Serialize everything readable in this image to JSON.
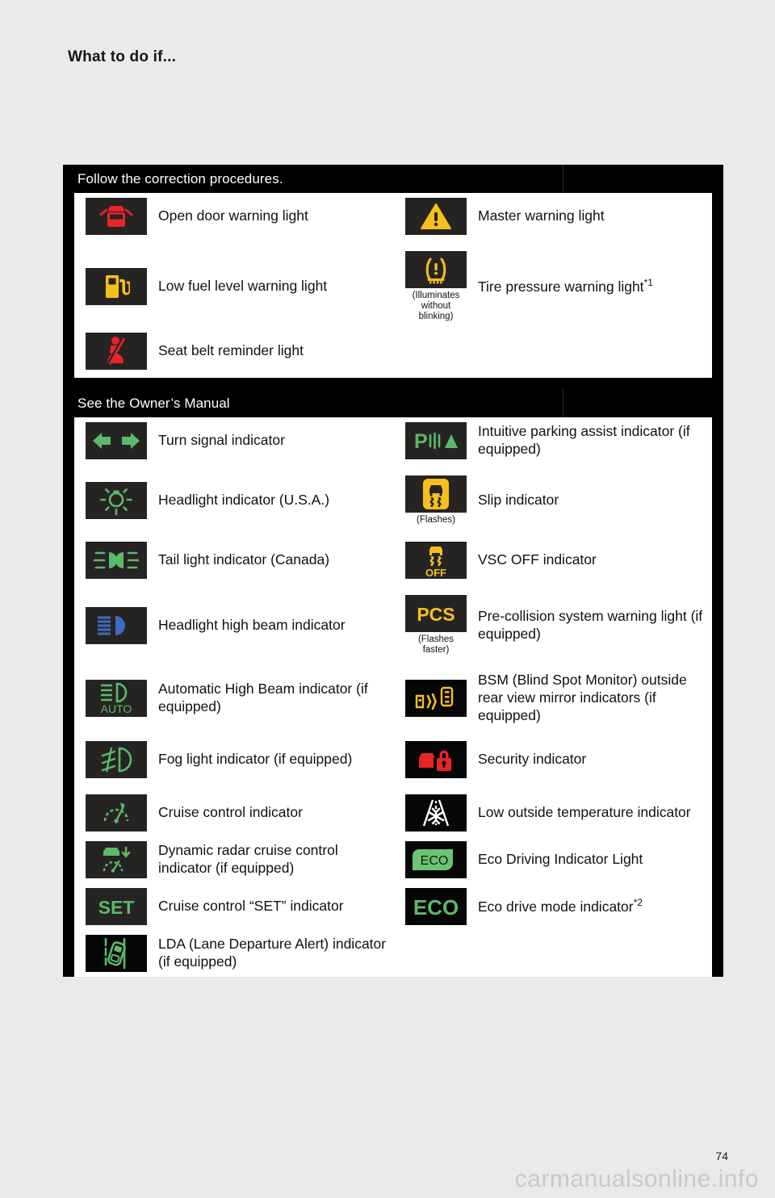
{
  "page": {
    "title": "What to do if...",
    "page_number": "74",
    "watermark": "carmanualsonline.info"
  },
  "colors": {
    "green": "#5cb96a",
    "yellow": "#f5c01e",
    "red": "#e8232a",
    "blue": "#3c6cc4",
    "white": "#ffffff",
    "tile_bg": "#262422",
    "tile_bg_black": "#060606"
  },
  "sections": [
    {
      "id": "follow-the-correction-procedures",
      "heading": "Follow the correction procedures.",
      "rows": [
        {
          "left": {
            "icon": "open-door-warning-icon",
            "label": "Open door warning light",
            "note": ""
          },
          "right": {
            "icon": "master-warning-icon",
            "label": "Master warning light",
            "note": ""
          }
        },
        {
          "left": {
            "icon": "low-fuel-level-icon",
            "label": "Low fuel level warning light",
            "note": ""
          },
          "right": {
            "icon": "tire-pressure-warning-icon",
            "label": "Tire pressure warning light",
            "sup": "*1",
            "note": "(Illuminates\nwithout\nblinking)"
          }
        },
        {
          "left": {
            "icon": "seat-belt-reminder-icon",
            "label": "Seat belt reminder light",
            "note": ""
          },
          "right": null
        }
      ]
    },
    {
      "id": "see-the-owners-manual",
      "heading": "See the Owner’s Manual",
      "rows": [
        {
          "left": {
            "icon": "turn-signal-icon",
            "label": "Turn signal indicator",
            "note": ""
          },
          "right": {
            "icon": "intuitive-parking-assist-icon",
            "label": "Intuitive parking assist indicator (if equipped)",
            "note": ""
          }
        },
        {
          "left": {
            "icon": "headlight-usa-icon",
            "label": "Headlight indicator (U.S.A.)",
            "note": ""
          },
          "right": {
            "icon": "slip-indicator-icon",
            "label": "Slip indicator",
            "note": "(Flashes)"
          }
        },
        {
          "left": {
            "icon": "tail-light-canada-icon",
            "label": "Tail light indicator (Canada)",
            "note": ""
          },
          "right": {
            "icon": "vsc-off-icon",
            "label": "VSC OFF indicator",
            "note": ""
          }
        },
        {
          "left": {
            "icon": "headlight-high-beam-icon",
            "label": "Headlight high beam indicator",
            "note": ""
          },
          "right": {
            "icon": "pcs-warning-icon",
            "label": "Pre-collision system warning light (if equipped)",
            "note": "(Flashes\nfaster)"
          }
        },
        {
          "left": {
            "icon": "automatic-high-beam-icon",
            "label": "Automatic High Beam indicator (if equipped)",
            "note": ""
          },
          "right": {
            "icon": "bsm-mirror-icon",
            "label": "BSM (Blind Spot Monitor) outside rear view mirror indicators (if equipped)",
            "note": ""
          }
        },
        {
          "left": {
            "icon": "fog-light-icon",
            "label": "Fog light indicator (if equipped)",
            "note": ""
          },
          "right": {
            "icon": "security-indicator-icon",
            "label": "Security indicator",
            "note": ""
          }
        },
        {
          "left": {
            "icon": "cruise-control-icon",
            "label": "Cruise control indicator",
            "note": ""
          },
          "right": {
            "icon": "low-outside-temperature-icon",
            "label": "Low outside temperature indicator",
            "note": ""
          }
        },
        {
          "left": {
            "icon": "dynamic-radar-cruise-icon",
            "label": "Dynamic radar cruise control indicator (if equipped)",
            "note": ""
          },
          "right": {
            "icon": "eco-driving-leaf-icon",
            "label": "Eco Driving Indicator Light",
            "note": ""
          }
        },
        {
          "left": {
            "icon": "cruise-set-icon",
            "label": "Cruise control “SET” indicator",
            "note": ""
          },
          "right": {
            "icon": "eco-drive-mode-icon",
            "label": "Eco drive mode indicator",
            "sup": "*2",
            "note": ""
          }
        },
        {
          "left": {
            "icon": "lda-icon",
            "label": "LDA (Lane Departure Alert) indicator (if equipped)",
            "note": ""
          },
          "right": null
        }
      ]
    }
  ]
}
